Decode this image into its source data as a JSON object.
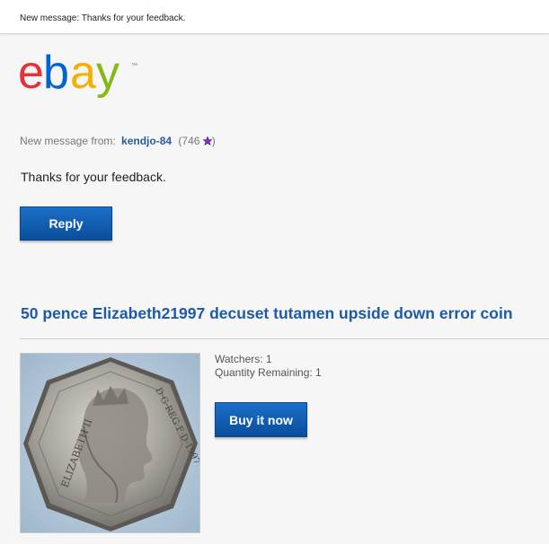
{
  "notification": {
    "text": "New message: Thanks for your feedback."
  },
  "brand": {
    "logo_letters": [
      "e",
      "b",
      "a",
      "y"
    ],
    "logo_colors": [
      "#e53238",
      "#0064d2",
      "#f5af02",
      "#86b817"
    ],
    "trademark": "™"
  },
  "message": {
    "from_prefix": "New message from:",
    "sender": "kendjo-84",
    "rating_open": "(746",
    "rating_close": ")",
    "rating_icon": "star-icon",
    "rating_icon_color": "#8a2be2",
    "body": "Thanks for your feedback.",
    "reply_label": "Reply"
  },
  "item": {
    "title": "50 pence Elizabeth21997 decuset tutamen upside down error coin",
    "watchers": "Watchers: 1",
    "quantity": "Quantity Remaining: 1",
    "buy_label": "Buy it now",
    "coin_legend_left": "ELIZABETH II",
    "coin_legend_right": "D·G·REG·F·D·1997"
  },
  "colors": {
    "link": "#1d5aa8",
    "button": "#0a5bb3"
  }
}
